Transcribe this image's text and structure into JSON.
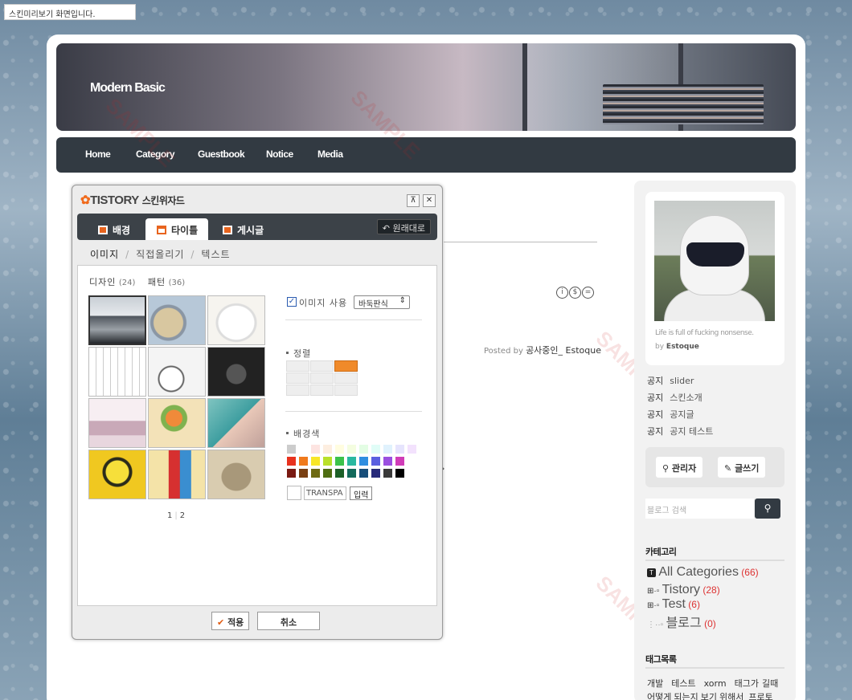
{
  "top_notice": "스킨미리보기 화면입니다.",
  "blog": {
    "title": "Modern Basic",
    "nav": [
      "Home",
      "Category",
      "Guestbook",
      "Notice",
      "Media"
    ],
    "watermark": "SAMPLE",
    "posted_prefix": "Posted by",
    "posted_author": "공사중인_ Estoque",
    "arrow": "›",
    "cc_icons": [
      "i",
      "$",
      "="
    ]
  },
  "sidebar": {
    "quote": "Life is full of fucking nonsense.",
    "by_prefix": "by",
    "by_name": "Estoque",
    "notices": [
      {
        "k": "공지",
        "v": "slider"
      },
      {
        "k": "공지",
        "v": "스킨소개"
      },
      {
        "k": "공지",
        "v": "공지글"
      },
      {
        "k": "공지",
        "v": "공지 테스트"
      }
    ],
    "admin_label": "관리자",
    "write_label": "글쓰기",
    "search_placeholder": "블로그 검색",
    "category_title": "카테고리",
    "categories": [
      {
        "name": "All Categories",
        "count": "(66)"
      },
      {
        "name": "Tistory",
        "count": "(28)"
      },
      {
        "name": "Test",
        "count": "(6)"
      },
      {
        "name": "블로그",
        "count": "(0)"
      }
    ],
    "tag_title": "태그목록",
    "tags": [
      "개발",
      "테스트",
      "xorm",
      "태그가",
      "길때",
      "어떻게",
      "되는지",
      "보기",
      "위해서",
      "프로토타"
    ]
  },
  "wizard": {
    "logo": "TISTORY",
    "subtitle": "스킨위자드",
    "tabs": [
      "배경",
      "타이틀",
      "게시글"
    ],
    "active_tab": "타이틀",
    "reset_label": "원래대로",
    "subtabs": [
      "이미지",
      "직접올리기",
      "텍스트"
    ],
    "panel_tabs": [
      {
        "label": "디자인",
        "count": "(24)"
      },
      {
        "label": "패턴",
        "count": "(36)"
      }
    ],
    "use_image_label": "이미지 사용",
    "use_image_checked": true,
    "tile_option": "바둑판식",
    "align_label": "정렬",
    "bg_color_label": "배경색",
    "transparent_value": "TRANSPA",
    "input_button": "입력",
    "pages": [
      "1",
      "2"
    ],
    "apply_label": "적용",
    "cancel_label": "취소",
    "palette": [
      [
        "#cccccc",
        "#ffffff",
        "#fde4e1",
        "#fdeee0",
        "#fffde0",
        "#f4fde0",
        "#e3fde4",
        "#e0fdf7",
        "#e0f2fd",
        "#e6e4fd",
        "#f3e2fd"
      ],
      [
        "#e8321e",
        "#f07a1c",
        "#f8e628",
        "#b9e02a",
        "#3cc24a",
        "#2ab8a0",
        "#2f8ee0",
        "#5a5fe0",
        "#9a4fe0",
        "#d03cb8"
      ],
      [
        "#7a1a12",
        "#7a4012",
        "#6e6a12",
        "#4f6e12",
        "#1d6028",
        "#136a5c",
        "#174e7a",
        "#272a7a",
        "#3a3a3a",
        "#000000"
      ]
    ]
  }
}
